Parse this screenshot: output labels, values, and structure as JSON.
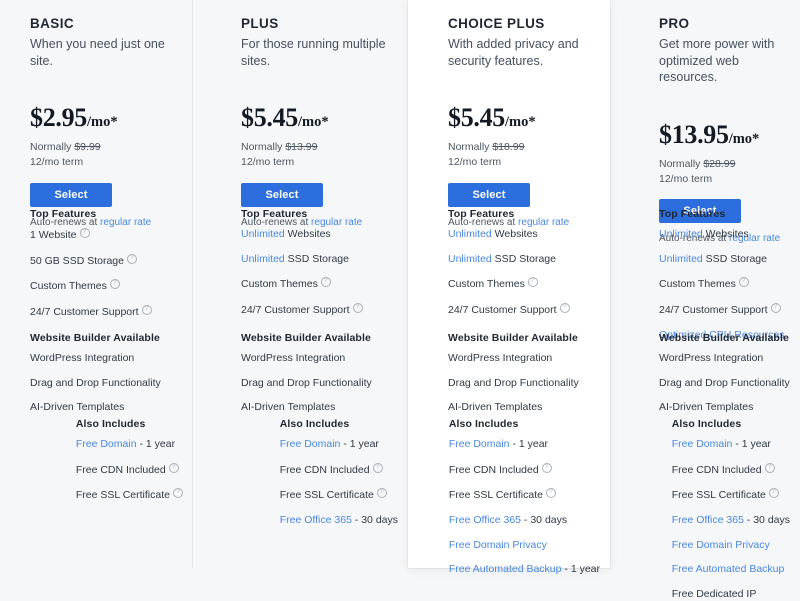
{
  "accent_blue": "#2c6ede",
  "link_blue": "#4a88e0",
  "bg_gray": "#f6f7f8",
  "card_white": "#ffffff",
  "labels": {
    "select": "Select",
    "auto_renews_prefix": "Auto-renews at ",
    "regular_rate": "regular rate",
    "top_features": "Top Features",
    "website_builder": "Website Builder Available",
    "also_includes": "Also Includes",
    "info_icon": "info-icon"
  },
  "plans": [
    {
      "name": "BASIC",
      "description": "When you need just one site.",
      "price": "$2.95",
      "per": "/mo*",
      "normally_prefix": "Normally ",
      "normally_price": "$9.99",
      "term": "12/mo term",
      "featured": false,
      "top_features": [
        {
          "link_text": "",
          "text": "1 Website",
          "info": true
        },
        {
          "link_text": "",
          "text": "50 GB SSD Storage",
          "info": true
        },
        {
          "link_text": "",
          "text": "Custom Themes",
          "info": true
        },
        {
          "link_text": "",
          "text": "24/7 Customer Support",
          "info": true
        }
      ],
      "builder_features": [
        "WordPress Integration",
        "Drag and Drop Functionality",
        "AI-Driven Templates"
      ],
      "also_includes": [
        {
          "link_text": "Free Domain",
          "text": " - 1 year",
          "info": false
        },
        {
          "link_text": "",
          "text": "Free CDN Included",
          "info": true
        },
        {
          "link_text": "",
          "text": "Free SSL Certificate",
          "info": true
        }
      ]
    },
    {
      "name": "PLUS",
      "description": "For those running multiple sites.",
      "price": "$5.45",
      "per": "/mo*",
      "normally_prefix": "Normally ",
      "normally_price": "$13.99",
      "term": "12/mo term",
      "featured": false,
      "top_features": [
        {
          "link_text": "Unlimited",
          "text": " Websites",
          "info": false
        },
        {
          "link_text": "Unlimited",
          "text": " SSD Storage",
          "info": false
        },
        {
          "link_text": "",
          "text": "Custom Themes",
          "info": true
        },
        {
          "link_text": "",
          "text": "24/7 Customer Support",
          "info": true
        }
      ],
      "builder_features": [
        "WordPress Integration",
        "Drag and Drop Functionality",
        "AI-Driven Templates"
      ],
      "also_includes": [
        {
          "link_text": "Free Domain",
          "text": " - 1 year",
          "info": false
        },
        {
          "link_text": "",
          "text": "Free CDN Included",
          "info": true
        },
        {
          "link_text": "",
          "text": "Free SSL Certificate",
          "info": true
        },
        {
          "link_text": "Free Office 365",
          "text": " - 30 days",
          "info": false
        }
      ]
    },
    {
      "name": "CHOICE PLUS",
      "description": "With added privacy and security features.",
      "price": "$5.45",
      "per": "/mo*",
      "normally_prefix": "Normally ",
      "normally_price": "$18.99",
      "term": "12/mo term",
      "featured": true,
      "top_features": [
        {
          "link_text": "Unlimited",
          "text": " Websites",
          "info": false
        },
        {
          "link_text": "Unlimited",
          "text": " SSD Storage",
          "info": false
        },
        {
          "link_text": "",
          "text": "Custom Themes",
          "info": true
        },
        {
          "link_text": "",
          "text": "24/7 Customer Support",
          "info": true
        }
      ],
      "builder_features": [
        "WordPress Integration",
        "Drag and Drop Functionality",
        "AI-Driven Templates"
      ],
      "also_includes": [
        {
          "link_text": "Free Domain",
          "text": " - 1 year",
          "info": false
        },
        {
          "link_text": "",
          "text": "Free CDN Included",
          "info": true
        },
        {
          "link_text": "",
          "text": "Free SSL Certificate",
          "info": true
        },
        {
          "link_text": "Free Office 365",
          "text": " - 30 days",
          "info": false
        },
        {
          "link_text": "Free Domain Privacy",
          "text": "",
          "info": false
        },
        {
          "link_text": "Free Automated Backup",
          "text": " - 1 year",
          "info": false
        }
      ]
    },
    {
      "name": "PRO",
      "description": "Get more power with optimized web resources.",
      "price": "$13.95",
      "per": "/mo*",
      "normally_prefix": "Normally ",
      "normally_price": "$28.99",
      "term": "12/mo term",
      "featured": false,
      "top_features": [
        {
          "link_text": "Unlimited",
          "text": " Websites",
          "info": false
        },
        {
          "link_text": "Unlimited",
          "text": " SSD Storage",
          "info": false
        },
        {
          "link_text": "",
          "text": "Custom Themes",
          "info": true
        },
        {
          "link_text": "",
          "text": "24/7 Customer Support",
          "info": true
        },
        {
          "link_text": "Optimized CPU Resources",
          "text": "",
          "info": false
        }
      ],
      "builder_features": [
        "WordPress Integration",
        "Drag and Drop Functionality",
        "AI-Driven Templates"
      ],
      "also_includes": [
        {
          "link_text": "Free Domain",
          "text": " - 1 year",
          "info": false
        },
        {
          "link_text": "",
          "text": "Free CDN Included",
          "info": true
        },
        {
          "link_text": "",
          "text": "Free SSL Certificate",
          "info": true
        },
        {
          "link_text": "Free Office 365",
          "text": " - 30 days",
          "info": false
        },
        {
          "link_text": "Free Domain Privacy",
          "text": "",
          "info": false
        },
        {
          "link_text": "Free Automated Backup",
          "text": "",
          "info": false
        },
        {
          "link_text": "",
          "text": "Free Dedicated IP",
          "info": false
        }
      ]
    }
  ]
}
